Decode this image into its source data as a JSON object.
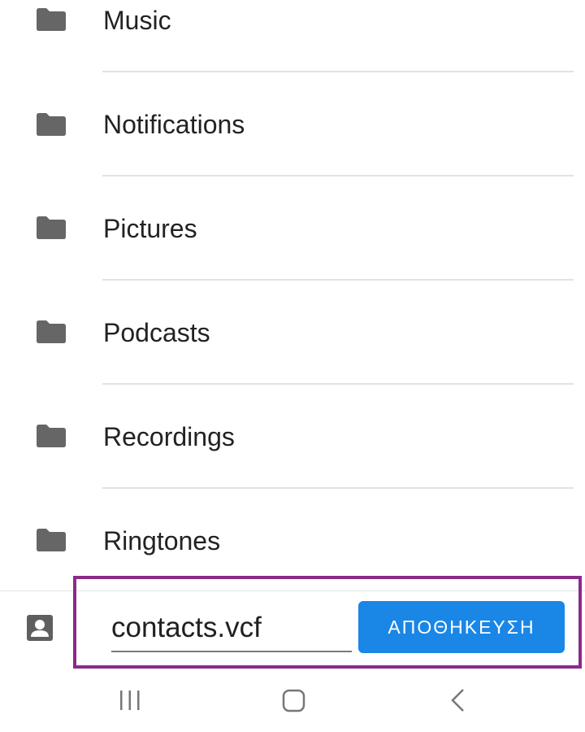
{
  "folders": [
    {
      "label": "Music",
      "icon": "folder-icon"
    },
    {
      "label": "Notifications",
      "icon": "folder-icon"
    },
    {
      "label": "Pictures",
      "icon": "folder-icon"
    },
    {
      "label": "Podcasts",
      "icon": "folder-icon"
    },
    {
      "label": "Recordings",
      "icon": "folder-icon"
    },
    {
      "label": "Ringtones",
      "icon": "folder-icon"
    }
  ],
  "save_panel": {
    "account_icon": "contact-icon",
    "filename_value": "contacts.vcf",
    "save_label": "ΑΠΟΘΗΚΕΥΣΗ"
  },
  "navigation": {
    "recents_icon": "recents-icon",
    "home_icon": "home-icon",
    "back_icon": "back-icon"
  },
  "colors": {
    "accent": "#1a86e6",
    "highlight_border": "#8a2a8a",
    "icon_gray": "#666666"
  }
}
